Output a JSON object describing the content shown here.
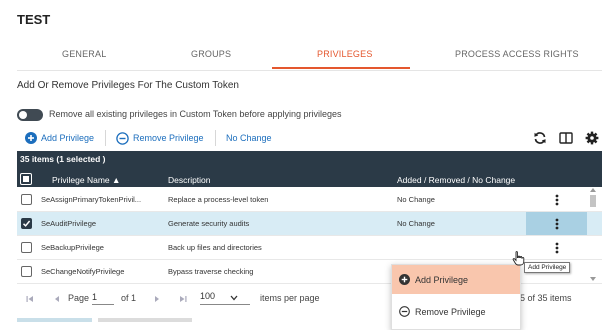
{
  "window": {
    "title": "TEST"
  },
  "tabs": [
    "GENERAL",
    "GROUPS",
    "PRIVILEGES",
    "PROCESS ACCESS RIGHTS"
  ],
  "active_tab": "PRIVILEGES",
  "section_heading": "Add Or Remove Privileges For The Custom Token",
  "remove_all_toggle": {
    "label": "Remove all existing privileges in Custom Token before applying privileges",
    "on": false
  },
  "toolbar": {
    "add_label": "Add Privilege",
    "remove_label": "Remove Privilege",
    "no_change_label": "No Change",
    "icons": [
      "refresh-icon",
      "columns-icon",
      "gear-icon"
    ]
  },
  "grid": {
    "selection_summary": "35 items (1 selected )",
    "columns": [
      "Privilege Name ▲",
      "Description",
      "Added / Removed / No Change"
    ],
    "rows": [
      {
        "name": "SeAssignPrimaryTokenPrivil...",
        "description": "Replace a process-level token",
        "status": "No Change",
        "checked": false
      },
      {
        "name": "SeAuditPrivilege",
        "description": "Generate security audits",
        "status": "No Change",
        "checked": true
      },
      {
        "name": "SeBackupPrivilege",
        "description": "Back up files and directories",
        "status": "",
        "checked": false
      },
      {
        "name": "SeChangeNotifyPrivilege",
        "description": "Bypass traverse checking",
        "status": "",
        "checked": false
      }
    ]
  },
  "context_menu": {
    "add_label": "Add Privilege",
    "remove_label": "Remove Privilege"
  },
  "tooltip": "Add Privilege",
  "pagination": {
    "page_label": "Page",
    "page_value": "1",
    "of_label": "of 1",
    "per_page_value": "100",
    "per_page_label": "items per page",
    "range_text": "1 - 35 of 35 items"
  },
  "colors": {
    "accent": "#e4572e",
    "link": "#1c6ebd",
    "header_bg": "#2b3a47",
    "selected_row": "#d8ecf5",
    "menu_hover": "#f9c6ad"
  }
}
